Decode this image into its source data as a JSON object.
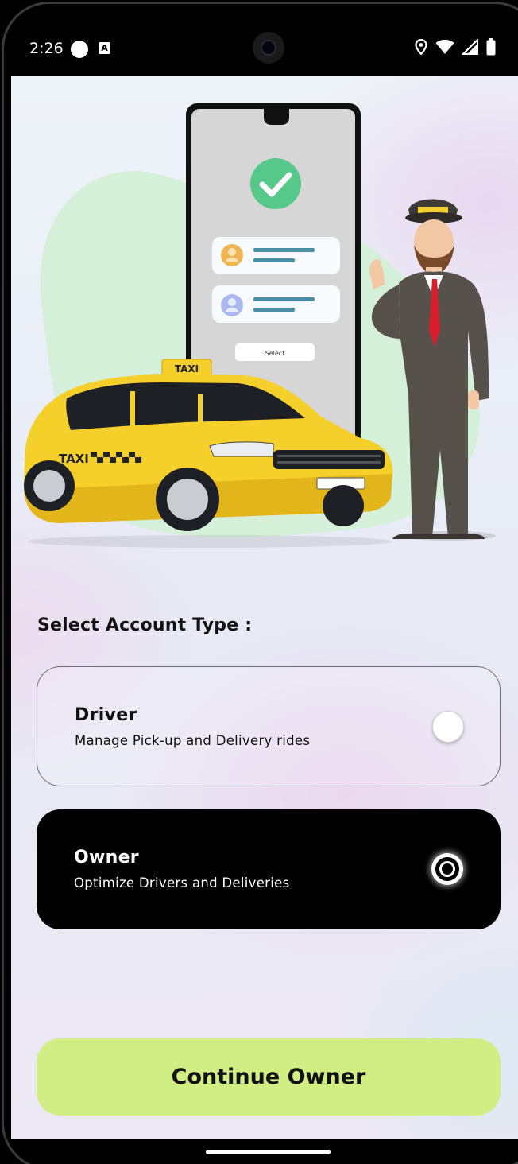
{
  "status_bar": {
    "time": "2:26",
    "notification_badge": "A",
    "icons": [
      "circle-icon",
      "a-notification-icon",
      "location-icon",
      "wifi-icon",
      "signal-icon",
      "battery-icon"
    ]
  },
  "hero": {
    "phone_button_label": "Select",
    "taxi_sign": "TAXI",
    "taxi_door_text": "TAXI",
    "colors": {
      "taxi_yellow": "#f5cf2a",
      "check_green": "#56c88a",
      "blob_green": "#d5f0d9"
    }
  },
  "account_selection": {
    "title": "Select Account Type :",
    "options": [
      {
        "id": "driver",
        "label": "Driver",
        "description": "Manage Pick-up and Delivery rides",
        "selected": false
      },
      {
        "id": "owner",
        "label": "Owner",
        "description": "Optimize Drivers and Deliveries",
        "selected": true
      }
    ]
  },
  "continue_button": {
    "label": "Continue Owner",
    "color": "#d0ee83"
  }
}
